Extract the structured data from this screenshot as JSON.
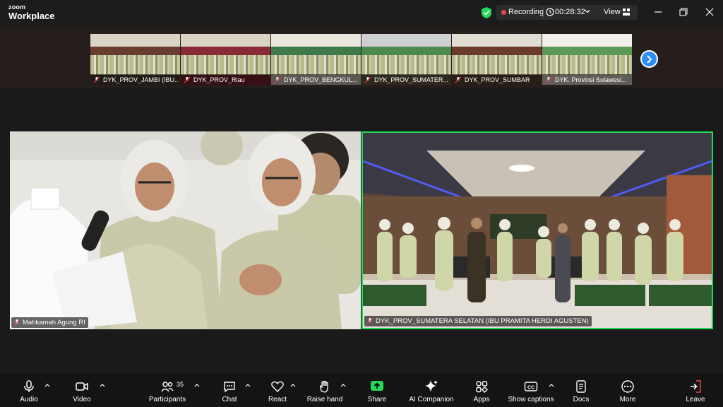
{
  "app": {
    "logo_line1": "zoom",
    "logo_line2": "Workplace"
  },
  "header": {
    "recording_label": "Recording",
    "timer": "00:28:32",
    "view_label": "View"
  },
  "gallery": {
    "thumbnails": [
      {
        "name": "DYK_PROV_JAMBI (IBU..."
      },
      {
        "name": "DYK_PROV_Riau"
      },
      {
        "name": "DYK_PROV_BENGKUL..."
      },
      {
        "name": "DYK_PROV_SUMATER..."
      },
      {
        "name": "DYK_PROV_SUMBAR"
      },
      {
        "name": "DYK. Provinsi Sulawesi..."
      }
    ]
  },
  "videos": [
    {
      "name": "Mahkamah Agung RI"
    },
    {
      "name": "DYK_PROV_SUMATERA  SELATAN (IBU  PRAMITA HERDI AGUSTEN)"
    }
  ],
  "toolbar": {
    "audio": "Audio",
    "video": "Video",
    "participants": "Participants",
    "participants_count": "35",
    "chat": "Chat",
    "react": "React",
    "raise_hand": "Raise hand",
    "share": "Share",
    "ai_companion": "AI Companion",
    "apps": "Apps",
    "show_captions": "Show captions",
    "docs": "Docs",
    "more": "More",
    "leave": "Leave"
  },
  "colors": {
    "share_green": "#23d959",
    "active_border": "#23d959",
    "next_blue": "#2d8cff",
    "leave_red": "#e8464a"
  }
}
